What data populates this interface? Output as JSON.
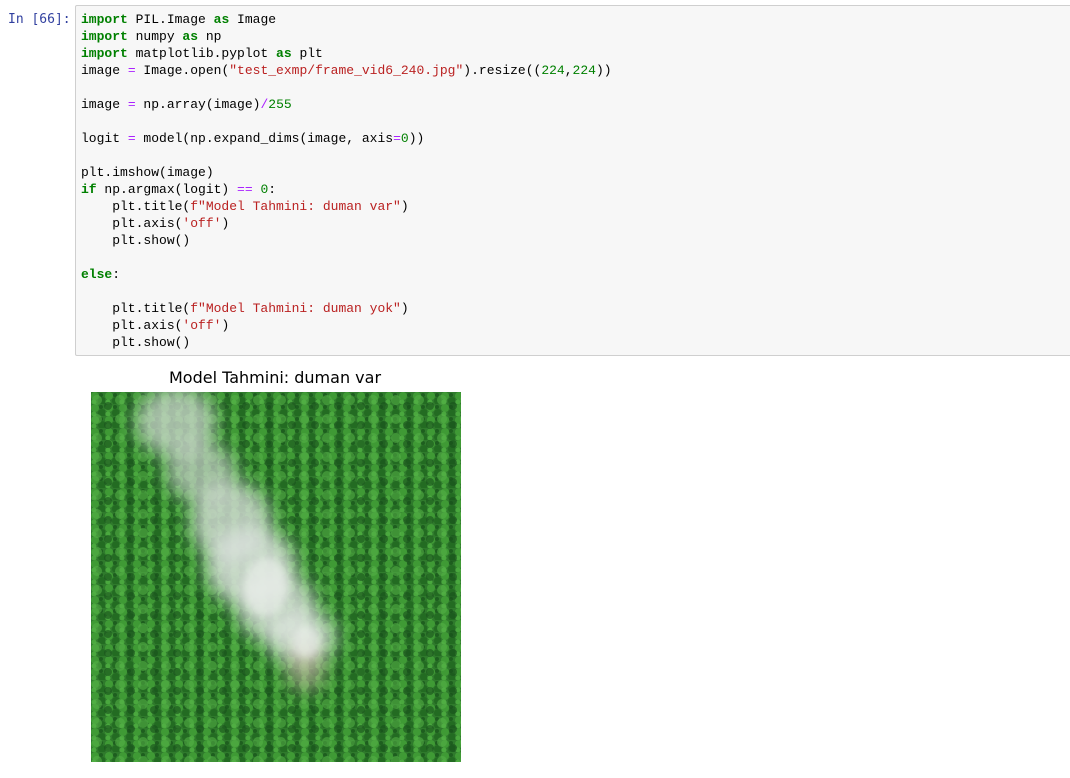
{
  "cell": {
    "prompt": "In [66]:",
    "lines": [
      [
        {
          "t": "import",
          "c": "kw"
        },
        {
          "t": " PIL.Image "
        },
        {
          "t": "as",
          "c": "kw"
        },
        {
          "t": " Image"
        }
      ],
      [
        {
          "t": "import",
          "c": "kw"
        },
        {
          "t": " numpy "
        },
        {
          "t": "as",
          "c": "kw"
        },
        {
          "t": " np"
        }
      ],
      [
        {
          "t": "import",
          "c": "kw"
        },
        {
          "t": " matplotlib.pyplot "
        },
        {
          "t": "as",
          "c": "kw"
        },
        {
          "t": " plt"
        }
      ],
      [
        {
          "t": "image "
        },
        {
          "t": "=",
          "c": "op"
        },
        {
          "t": " Image.open("
        },
        {
          "t": "\"test_exmp/frame_vid6_240.jpg\"",
          "c": "str"
        },
        {
          "t": ").resize(("
        },
        {
          "t": "224",
          "c": "num"
        },
        {
          "t": ","
        },
        {
          "t": "224",
          "c": "num"
        },
        {
          "t": "))"
        }
      ],
      [],
      [
        {
          "t": "image "
        },
        {
          "t": "=",
          "c": "op"
        },
        {
          "t": " np.array(image)"
        },
        {
          "t": "/",
          "c": "op"
        },
        {
          "t": "255",
          "c": "num"
        }
      ],
      [],
      [
        {
          "t": "logit "
        },
        {
          "t": "=",
          "c": "op"
        },
        {
          "t": " model(np.expand_dims(image, axis"
        },
        {
          "t": "=",
          "c": "op"
        },
        {
          "t": "0",
          "c": "num"
        },
        {
          "t": "))"
        }
      ],
      [],
      [
        {
          "t": "plt.imshow(image)"
        }
      ],
      [
        {
          "t": "if",
          "c": "kw"
        },
        {
          "t": " np.argmax(logit) "
        },
        {
          "t": "==",
          "c": "op"
        },
        {
          "t": " "
        },
        {
          "t": "0",
          "c": "num"
        },
        {
          "t": ":"
        }
      ],
      [
        {
          "t": "    plt.title("
        },
        {
          "t": "f\"Model Tahmini: duman var\"",
          "c": "str"
        },
        {
          "t": ")"
        }
      ],
      [
        {
          "t": "    plt.axis("
        },
        {
          "t": "'off'",
          "c": "str"
        },
        {
          "t": ")"
        }
      ],
      [
        {
          "t": "    plt.show()"
        }
      ],
      [],
      [
        {
          "t": "else",
          "c": "kw"
        },
        {
          "t": ":"
        }
      ],
      [],
      [
        {
          "t": "    plt.title("
        },
        {
          "t": "f\"Model Tahmini: duman yok\"",
          "c": "str"
        },
        {
          "t": ")"
        }
      ],
      [
        {
          "t": "    plt.axis("
        },
        {
          "t": "'off'",
          "c": "str"
        },
        {
          "t": ")"
        }
      ],
      [
        {
          "t": "    plt.show()"
        }
      ]
    ]
  },
  "output": {
    "plot_title": "Model Tahmini: duman var",
    "image_alt": "aerial view of green forest with smoke"
  },
  "colors": {
    "keyword": "#008000",
    "string": "#ba2121",
    "number": "#008000",
    "operator": "#aa22ff",
    "prompt": "#303f9f"
  }
}
